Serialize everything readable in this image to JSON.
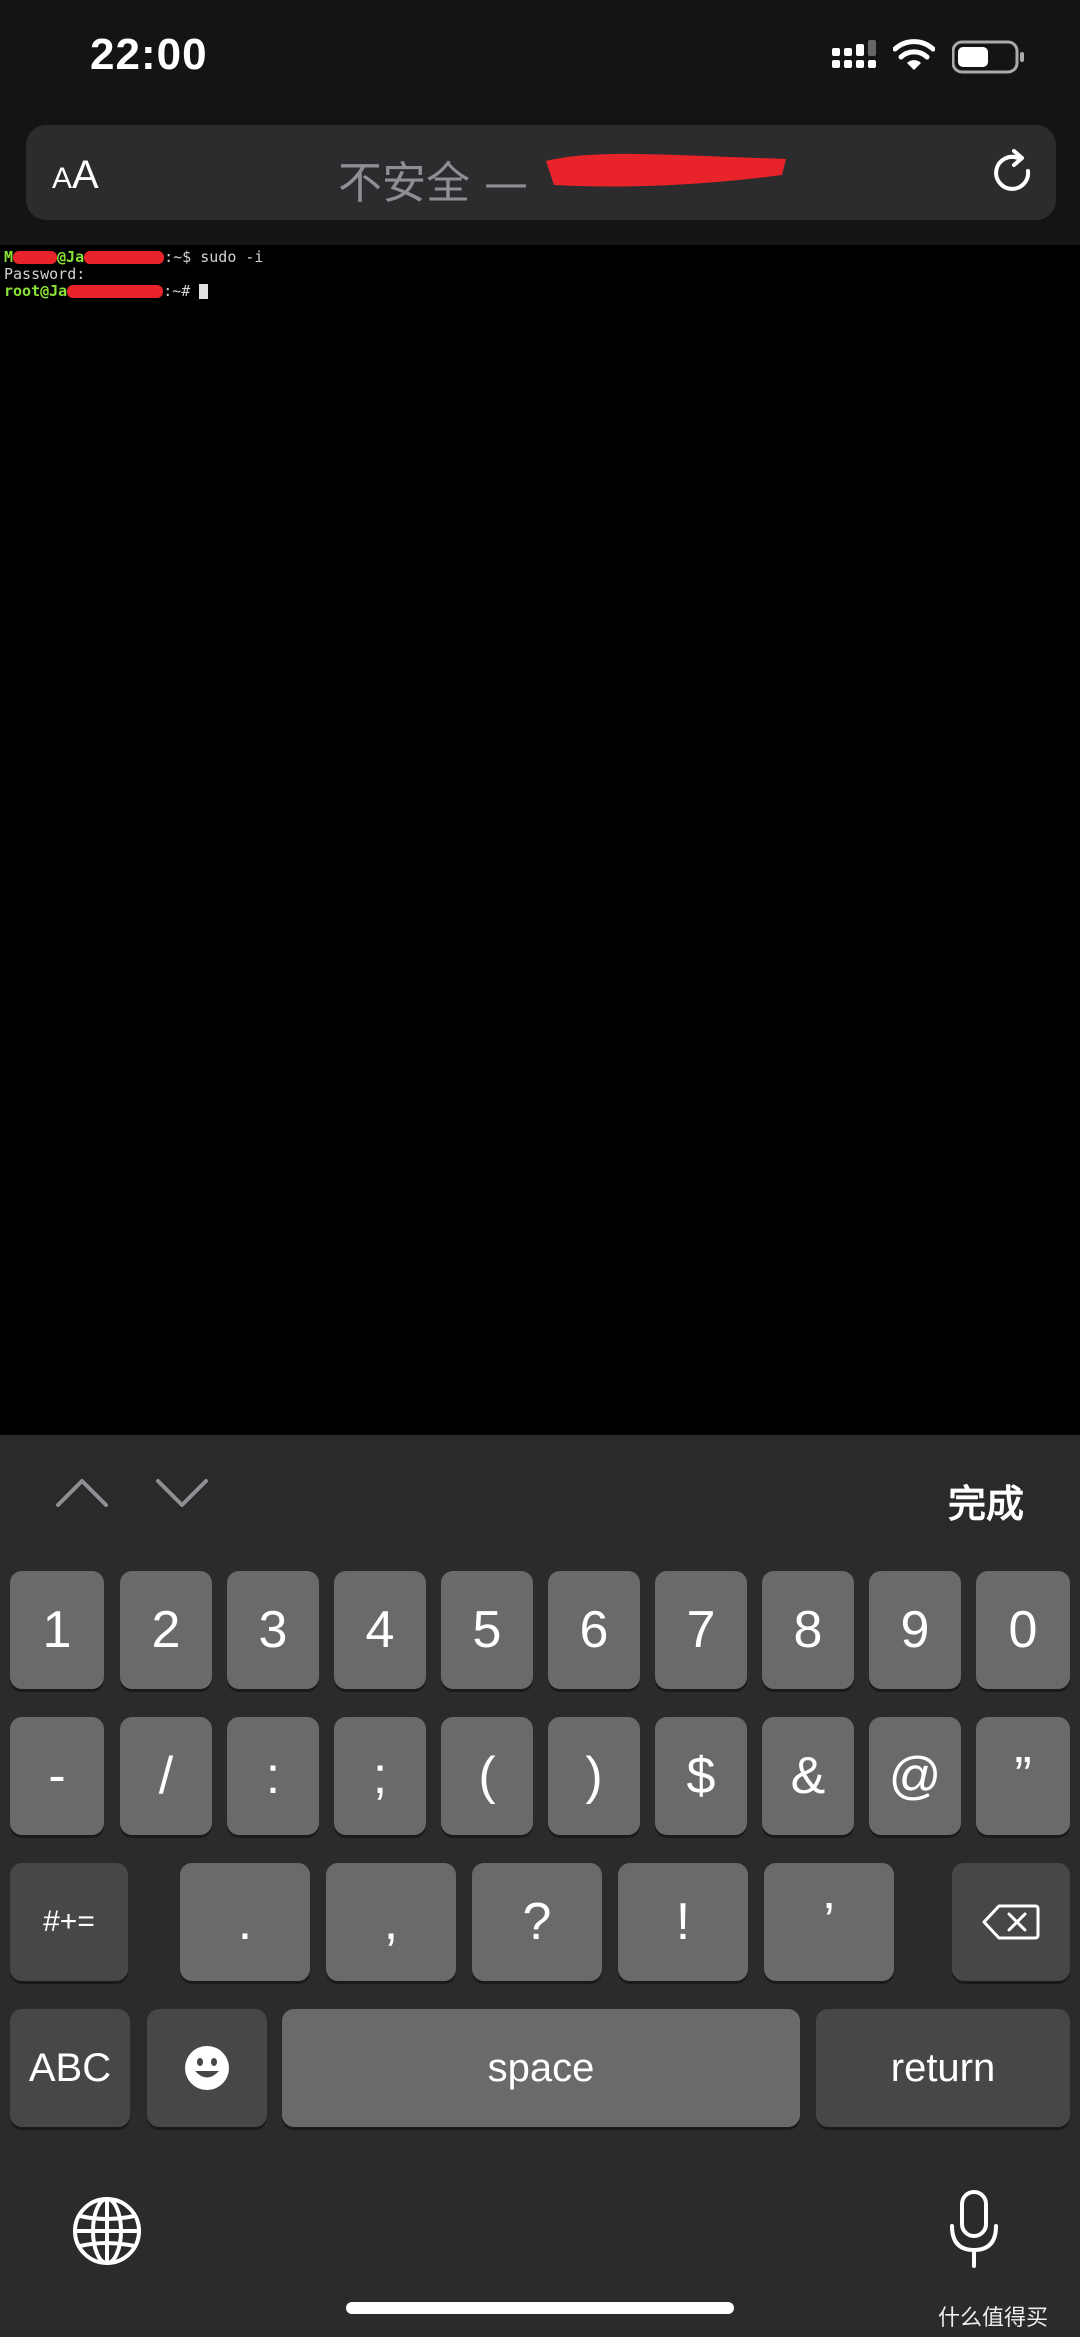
{
  "status_bar": {
    "time": "22:00"
  },
  "address_bar": {
    "text_size_label_small": "A",
    "text_size_label_large": "A",
    "url_prefix": "不安全 —"
  },
  "terminal": {
    "line1_user": "M",
    "line1_host_prefix": "@Ja",
    "line1_suffix": ":~$ ",
    "line1_command": "sudo -i",
    "line2": "Password:",
    "line3_user": "root@Ja",
    "line3_suffix": ":~# "
  },
  "accessory_bar": {
    "done_label": "完成"
  },
  "keyboard": {
    "row1": [
      "1",
      "2",
      "3",
      "4",
      "5",
      "6",
      "7",
      "8",
      "9",
      "0"
    ],
    "row2": [
      "-",
      "/",
      ":",
      ";",
      "(",
      ")",
      "$",
      "&",
      "@",
      "”"
    ],
    "row3": [
      ".",
      ",",
      "?",
      "!",
      "’"
    ],
    "shift_label": "#+=",
    "abc_label": "ABC",
    "space_label": "space",
    "return_label": "return"
  },
  "watermark": "什么值得买",
  "icons": [
    "signal-icon",
    "wifi-icon",
    "battery-icon",
    "reload-icon",
    "chevron-up-icon",
    "chevron-down-icon",
    "backspace-icon",
    "emoji-icon",
    "globe-icon",
    "microphone-icon"
  ]
}
